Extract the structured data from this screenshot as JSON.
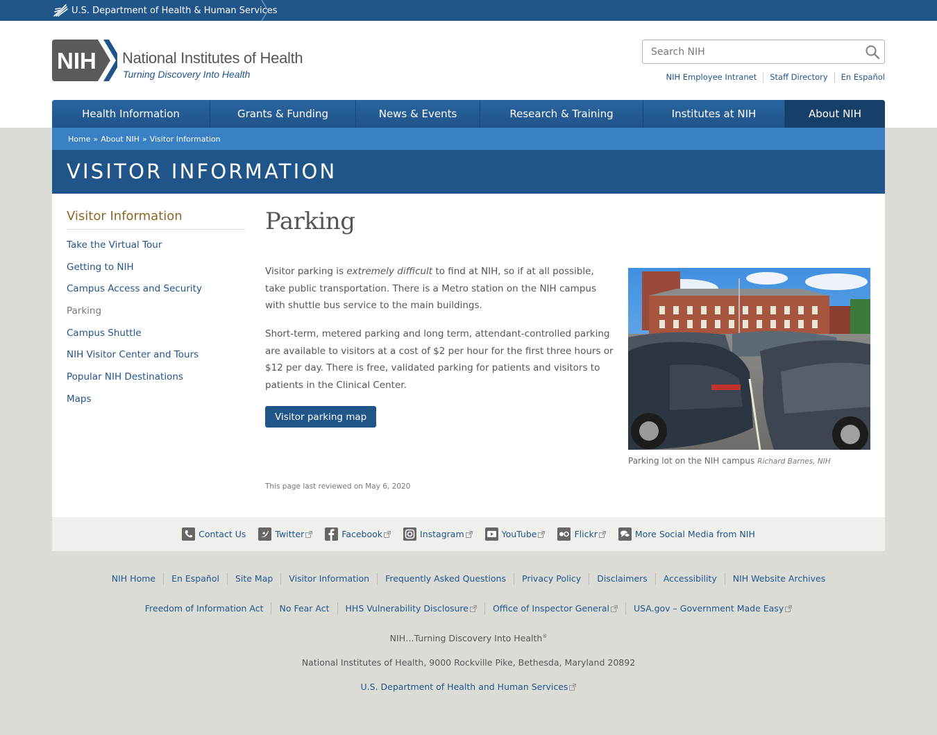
{
  "hhs": {
    "label": "U.S. Department of Health & Human Services"
  },
  "logo": {
    "badge": "NIH",
    "org": "National Institutes of Health",
    "tagline": "Turning Discovery Into Health"
  },
  "search": {
    "placeholder": "Search NIH"
  },
  "utility": [
    "NIH Employee Intranet",
    "Staff Directory",
    "En Español"
  ],
  "nav": [
    "Health Information",
    "Grants & Funding",
    "News & Events",
    "Research & Training",
    "Institutes at NIH",
    "About NIH"
  ],
  "breadcrumb": [
    "Home",
    "About NIH",
    "Visitor Information"
  ],
  "breadcrumb_sep": "»",
  "page_title": "VISITOR INFORMATION",
  "sidebar": {
    "heading": "Visitor Information",
    "items": [
      "Take the Virtual Tour",
      "Getting to NIH",
      "Campus Access and Security",
      "Parking",
      "Campus Shuttle",
      "NIH Visitor Center and Tours",
      "Popular NIH Destinations",
      "Maps"
    ]
  },
  "content": {
    "heading": "Parking",
    "p1_a": "Visitor parking is ",
    "p1_em": "extremely difficult",
    "p1_b": " to find at NIH, so if at all possible, take public transportation. There is a Metro station on the NIH campus with shuttle bus service to the main buildings.",
    "p2": "Short-term, metered parking and long term, attendant-controlled parking are available to visitors at a cost of $2 per hour for the first three hours or $12 per day. There is free, validated parking for patients and visitors to patients in the Clinical Center.",
    "button": "Visitor parking map",
    "reviewed": "This page last reviewed on May 6, 2020"
  },
  "figure": {
    "caption": "Parking lot on the NIH campus",
    "credit": "Richard Barnes, NIH"
  },
  "social": [
    "Contact Us",
    "Twitter",
    "Facebook",
    "Instagram",
    "YouTube",
    "Flickr",
    "More Social Media from NIH"
  ],
  "footer": {
    "row1": [
      "NIH Home",
      "En Español",
      "Site Map",
      "Visitor Information",
      "Frequently Asked Questions",
      "Privacy Policy",
      "Disclaimers",
      "Accessibility",
      "NIH Website Archives"
    ],
    "row2": [
      "Freedom of Information Act",
      "No Fear Act",
      "HHS Vulnerability Disclosure",
      "Office of Inspector General",
      "USA.gov – Government Made Easy"
    ],
    "tagline": "NIH…Turning Discovery Into Health",
    "tagline_mark": "®",
    "address": "National Institutes of Health, 9000 Rockville Pike, Bethesda, Maryland 20892",
    "hhs_link": "U.S. Department of Health and Human Services"
  },
  "colors": {
    "brand_blue": "#20558a",
    "light_blue": "#3a80c4",
    "sidebar_heading": "#8d6726"
  }
}
